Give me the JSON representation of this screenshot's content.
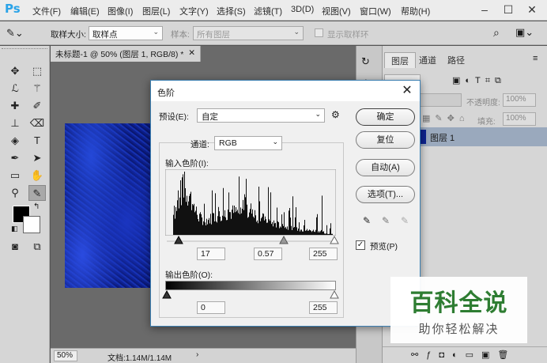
{
  "menubar": {
    "logo": "Ps",
    "items": [
      "文件(F)",
      "编辑(E)",
      "图像(I)",
      "图层(L)",
      "文字(Y)",
      "选择(S)",
      "滤镜(T)",
      "3D(D)",
      "视图(V)",
      "窗口(W)",
      "帮助(H)"
    ]
  },
  "options": {
    "sample_size_label": "取样大小:",
    "sample_size_value": "取样点",
    "sample_label": "样本:",
    "sample_value": "所有图层",
    "show_ring_label": "显示取样环"
  },
  "document": {
    "tab_title": "未标题-1 @ 50% (图层 1, RGB/8) *",
    "zoom": "50%",
    "doc_info": "文档:1.14M/1.14M"
  },
  "layers_panel": {
    "tabs": [
      "图层",
      "通道",
      "路径"
    ],
    "opacity_label": "不透明度:",
    "opacity_value": "100%",
    "fill_label": "填充:",
    "fill_value": "100%",
    "layer_name": "图层 1"
  },
  "dialog": {
    "title": "色阶",
    "preset_label": "预设(E):",
    "preset_value": "自定",
    "channel_label": "通道:",
    "channel_value": "RGB",
    "input_levels_label": "输入色阶(I):",
    "input_black": "17",
    "input_gamma": "0.57",
    "input_white": "255",
    "output_levels_label": "输出色阶(O):",
    "output_black": "0",
    "output_white": "255",
    "buttons": {
      "ok": "确定",
      "reset": "复位",
      "auto": "自动(A)",
      "options": "选项(T)..."
    },
    "preview_label": "预览(P)",
    "preview_checked": true
  },
  "watermark": {
    "title": "百科全说",
    "subtitle": "助你轻松解决"
  },
  "colors": {
    "accent": "#2aa3e8",
    "dialog_border": "#3c7fb1",
    "layer_selected": "#9aa9bd",
    "watermark_green": "#2e7d32"
  }
}
